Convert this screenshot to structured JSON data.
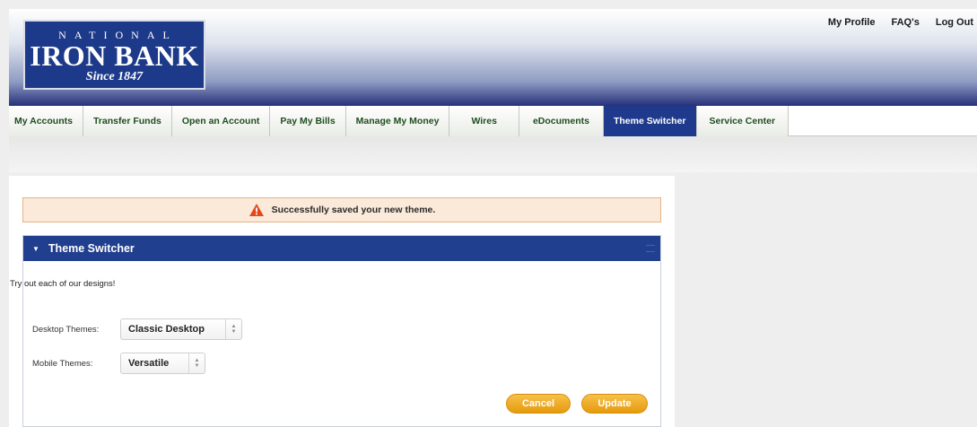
{
  "brand": {
    "top": "NATIONAL",
    "main": "IRON BANK",
    "since": "Since 1847"
  },
  "top_links": [
    "My Profile",
    "FAQ's",
    "Log Out"
  ],
  "nav": {
    "tabs": [
      {
        "label": "My Accounts"
      },
      {
        "label": "Transfer Funds"
      },
      {
        "label": "Open an Account"
      },
      {
        "label": "Pay My Bills"
      },
      {
        "label": "Manage My Money"
      },
      {
        "label": "Wires"
      },
      {
        "label": "eDocuments"
      },
      {
        "label": "Theme Switcher"
      },
      {
        "label": "Service Center"
      }
    ],
    "active": "Theme Switcher"
  },
  "alert": {
    "message": "Successfully saved your new theme.",
    "icon": "warning-icon"
  },
  "panel": {
    "title": "Theme Switcher",
    "intro": "Try out each of our designs!",
    "desktop": {
      "label": "Desktop Themes:",
      "value": "Classic Desktop"
    },
    "mobile": {
      "label": "Mobile Themes:",
      "value": "Versatile"
    },
    "cancel_label": "Cancel",
    "update_label": "Update"
  },
  "colors": {
    "brand_navy": "#1f3a8c",
    "tab_text": "#1f4d1f",
    "alert_bg": "#fbe9d9",
    "button_orange": "#f0a81e"
  }
}
